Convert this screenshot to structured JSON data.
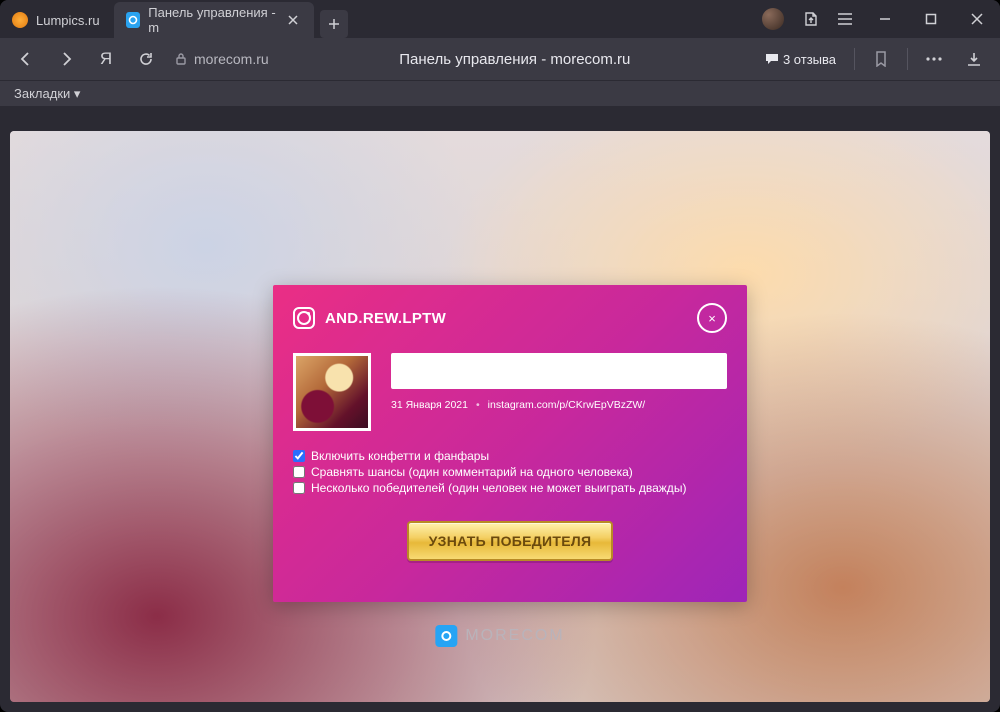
{
  "tabs": [
    {
      "label": "Lumpics.ru"
    },
    {
      "label": "Панель управления - m"
    }
  ],
  "toolbar": {
    "domain": "morecom.ru",
    "page_title": "Панель управления - morecom.ru",
    "reviews_label": "3 отзыва"
  },
  "bookmarks_bar": {
    "label": "Закладки"
  },
  "card": {
    "username": "AND.REW.LPTW",
    "date": "31 Января 2021",
    "link": "instagram.com/p/CKrwEpVBzZW/",
    "close": "×",
    "options": [
      {
        "label": "Включить конфетти и фанфары",
        "checked": true
      },
      {
        "label": "Сравнять шансы (один комментарий на одного человека)",
        "checked": false
      },
      {
        "label": "Несколько победителей (один человек не может выиграть дважды)",
        "checked": false
      }
    ],
    "button": "УЗНАТЬ ПОБЕДИТЕЛЯ"
  },
  "brand": "MORECOM"
}
